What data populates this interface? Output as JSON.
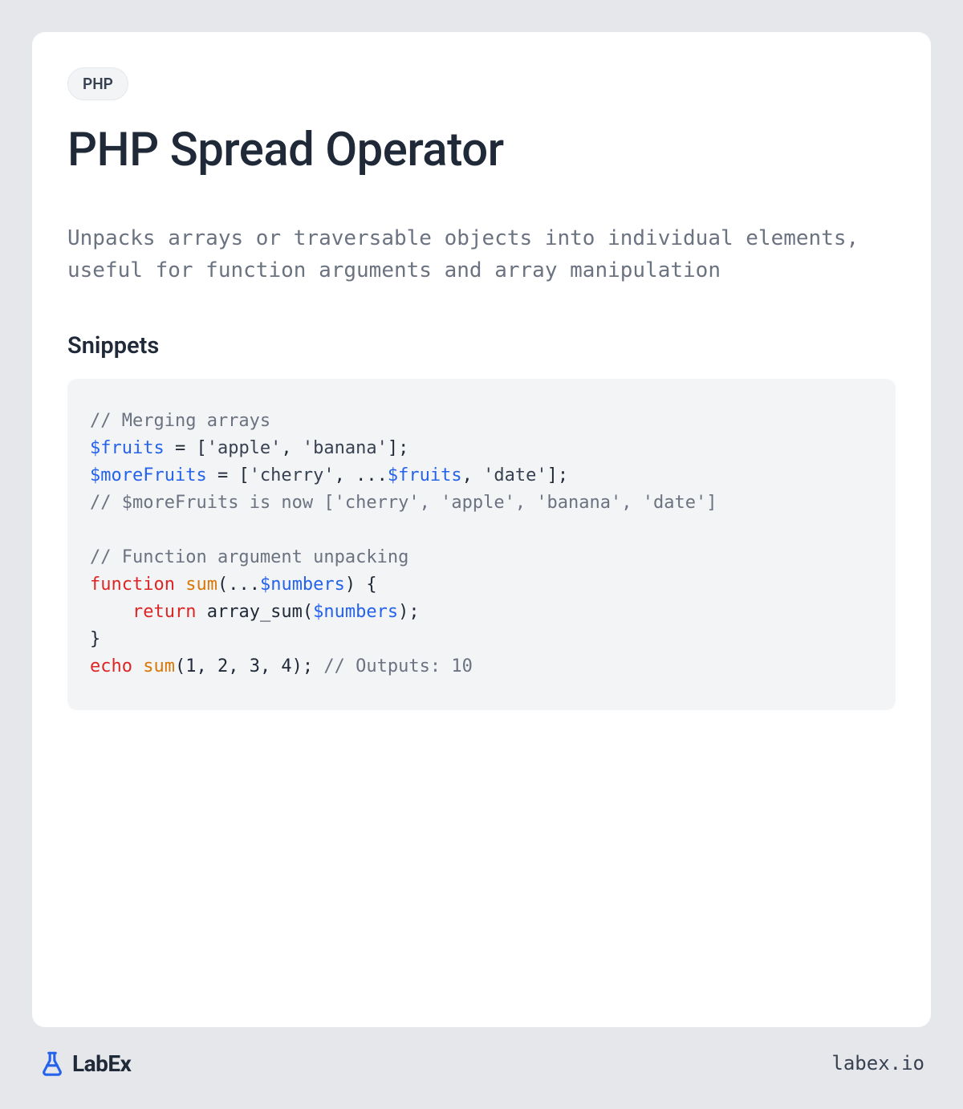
{
  "badge": "PHP",
  "title": "PHP Spread Operator",
  "description": "Unpacks arrays or traversable objects into individual elements, useful for function arguments and array manipulation",
  "snippets_heading": "Snippets",
  "code": {
    "c1": "// Merging arrays",
    "v_fruits": "$fruits",
    "eq": " = [",
    "s_apple": "'apple'",
    "comma": ", ",
    "s_banana": "'banana'",
    "close_arr": "];",
    "v_moreFruits": "$moreFruits",
    "eq2": " = [",
    "s_cherry": "'cherry'",
    "spread": ", ...",
    "v_fruits2": "$fruits",
    "comma2": ", ",
    "s_date": "'date'",
    "close_arr2": "];",
    "c2a": "// ",
    "c2_var": "$moreFruits",
    "c2b": " is now ['cherry', 'apple', 'banana', 'date']",
    "c3": "// Function argument unpacking",
    "kw_function": "function",
    "sp": " ",
    "fn_sum": "sum",
    "open_paren_spread": "(...",
    "v_numbers": "$numbers",
    "close_paren_brace": ") {",
    "indent_return": "    ",
    "kw_return": "return",
    "sp2": " array_sum(",
    "v_numbers2": "$numbers",
    "close_call": ");",
    "close_brace": "}",
    "kw_echo": "echo",
    "sp3": " ",
    "fn_sum2": "sum",
    "args": "(1, 2, 3, 4); ",
    "c4": "// Outputs: 10"
  },
  "footer": {
    "brand": "LabEx",
    "url": "labex.io"
  }
}
